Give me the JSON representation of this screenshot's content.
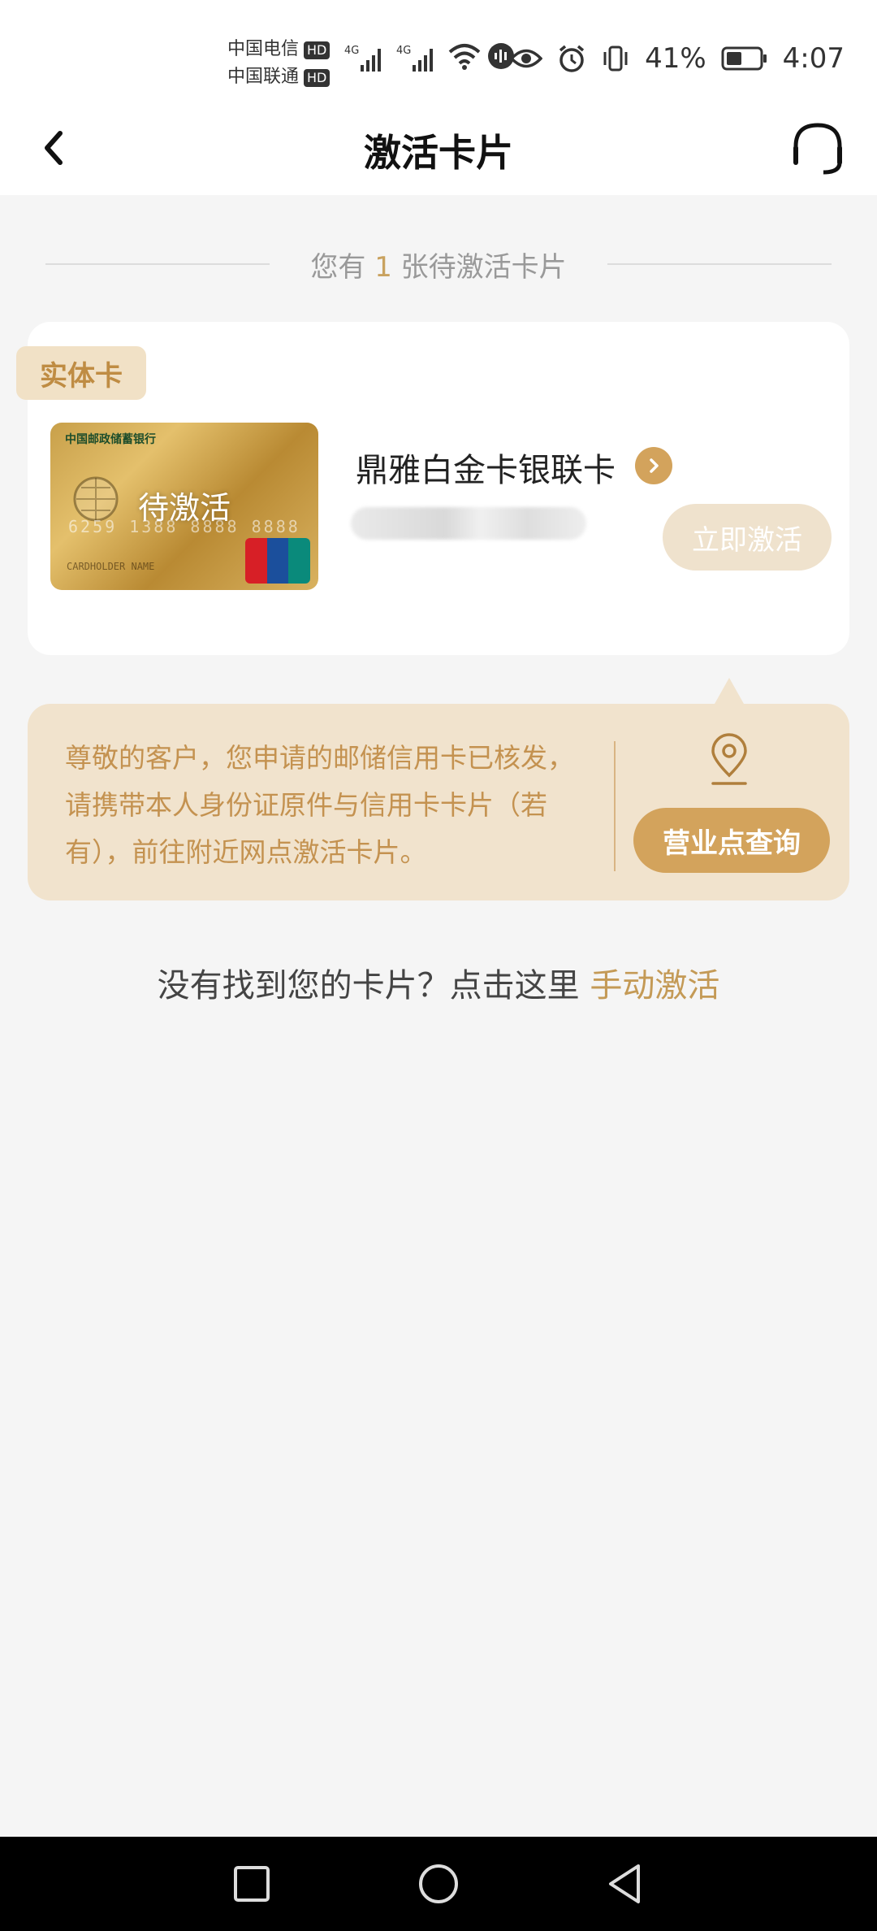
{
  "status_bar": {
    "carrier_1": "中国电信",
    "carrier_2": "中国联通",
    "hd_badge": "HD",
    "network_1": "4G",
    "network_2": "4G",
    "battery_percent": "41%",
    "time": "4:07"
  },
  "nav": {
    "title": "激活卡片"
  },
  "summary": {
    "prefix": "您有",
    "count": "1",
    "suffix": "张待激活卡片"
  },
  "card": {
    "type_tag": "实体卡",
    "status_label": "待激活",
    "bank_name": "中国邮政储蓄银行",
    "number_preview": "6259 1388 8888 8888",
    "holder_text": "CARDHOLDER NAME",
    "name": "鼎雅白金卡银联卡",
    "activate_label": "立即激活"
  },
  "notice": {
    "text": "尊敬的客户，您申请的邮储信用卡已核发，请携带本人身份证原件与信用卡卡片（若有），前往附近网点激活卡片。",
    "branch_button": "营业点查询"
  },
  "manual": {
    "prompt": "没有找到您的卡片？点击这里",
    "link": "手动激活"
  },
  "colors": {
    "accent": "#d3a35c",
    "accent_text": "#c49250",
    "notice_bg": "#f1e3cd",
    "page_bg": "#f5f5f5"
  }
}
